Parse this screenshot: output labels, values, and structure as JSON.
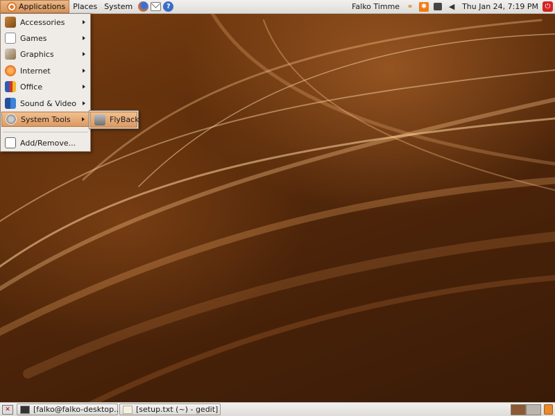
{
  "top_panel": {
    "menus": [
      "Applications",
      "Places",
      "System"
    ],
    "launchers": [
      "firefox-icon",
      "mail-icon",
      "help-icon"
    ],
    "user_name": "Falko Timme",
    "clock": "Thu Jan 24,  7:19 PM",
    "tray_icons": [
      "link-icon",
      "update-notifier-icon",
      "network-icon",
      "volume-icon",
      "power-icon"
    ]
  },
  "app_menu": {
    "items": [
      {
        "label": "Accessories",
        "icon": "accessories-icon"
      },
      {
        "label": "Games",
        "icon": "games-icon"
      },
      {
        "label": "Graphics",
        "icon": "graphics-icon"
      },
      {
        "label": "Internet",
        "icon": "internet-icon"
      },
      {
        "label": "Office",
        "icon": "office-icon"
      },
      {
        "label": "Sound & Video",
        "icon": "sound-video-icon"
      },
      {
        "label": "System Tools",
        "icon": "system-tools-icon",
        "highlighted": true
      }
    ],
    "footer_item": {
      "label": "Add/Remove...",
      "icon": "add-remove-icon"
    }
  },
  "submenu": {
    "items": [
      {
        "label": "FlyBack",
        "icon": "flyback-icon"
      }
    ]
  },
  "taskbar": {
    "windows": [
      {
        "label": "[falko@falko-desktop...",
        "icon": "terminal-icon"
      },
      {
        "label": "[setup.txt (~) - gedit]",
        "icon": "gedit-icon"
      }
    ],
    "workspaces": 2
  },
  "colors": {
    "highlight": "#dc9963",
    "panel": "#dedcd8",
    "wallpaper": "#4a2309"
  }
}
